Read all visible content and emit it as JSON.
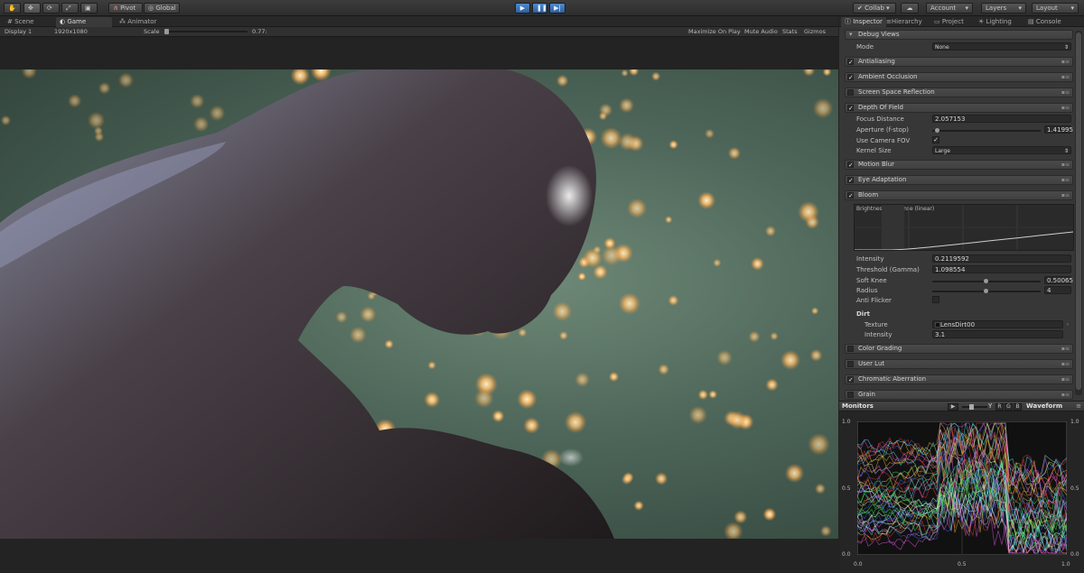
{
  "toolbar": {
    "pivot": "Pivot",
    "global": "Global",
    "collab": "Collab",
    "account": "Account",
    "layers": "Layers",
    "layout": "Layout"
  },
  "tabs": [
    "Scene",
    "Game",
    "Animator"
  ],
  "game_bar": {
    "display": "Display 1",
    "resolution": "1920x1080",
    "scale_label": "Scale",
    "scale_value": "0.77:",
    "maximize": "Maximize On Play",
    "mute": "Mute Audio",
    "stats": "Stats",
    "gizmos": "Gizmos"
  },
  "inspector_tabs": [
    "Inspector",
    "Hierarchy",
    "Project",
    "Lighting",
    "Console"
  ],
  "debug": {
    "title": "Debug Views",
    "mode_label": "Mode",
    "mode_value": "None"
  },
  "sections": {
    "antialiasing": "Antialiasing",
    "ambient_occlusion": "Ambient Occlusion",
    "ssr": "Screen Space Reflection",
    "dof": "Depth Of Field",
    "motion_blur": "Motion Blur",
    "eye_adaptation": "Eye Adaptation",
    "bloom": "Bloom",
    "color_grading": "Color Grading",
    "user_lut": "User Lut",
    "chromatic_aberration": "Chromatic Aberration",
    "grain": "Grain"
  },
  "dof": {
    "focus_label": "Focus Distance",
    "focus_value": "2.057153",
    "aperture_label": "Aperture (f-stop)",
    "aperture_value": "1.41995",
    "camfov_label": "Use Camera FOV",
    "kernel_label": "Kernel Size",
    "kernel_value": "Large"
  },
  "bloom": {
    "curve_title": "Brightness Response (linear)",
    "intensity_label": "Intensity",
    "intensity_value": "0.2119592",
    "threshold_label": "Threshold (Gamma)",
    "threshold_value": "1.098554",
    "knee_label": "Soft Knee",
    "knee_value": "0.50065",
    "radius_label": "Radius",
    "radius_value": "4",
    "flicker_label": "Anti Flicker",
    "dirt_title": "Dirt",
    "texture_label": "Texture",
    "texture_value": "LensDirt00",
    "dirt_intensity_label": "Intensity",
    "dirt_intensity_value": "3.1"
  },
  "monitors": {
    "title": "Monitors",
    "channels": [
      "Y",
      "R",
      "G",
      "B"
    ],
    "mode": "Waveform",
    "y_top": "1.0",
    "y_mid": "0.5",
    "y_bot": "0.0",
    "x_left": "0.0",
    "x_mid": "0.5",
    "x_right": "1.0"
  },
  "colors": {
    "accent": "#3a78c8",
    "panel": "#373737"
  }
}
